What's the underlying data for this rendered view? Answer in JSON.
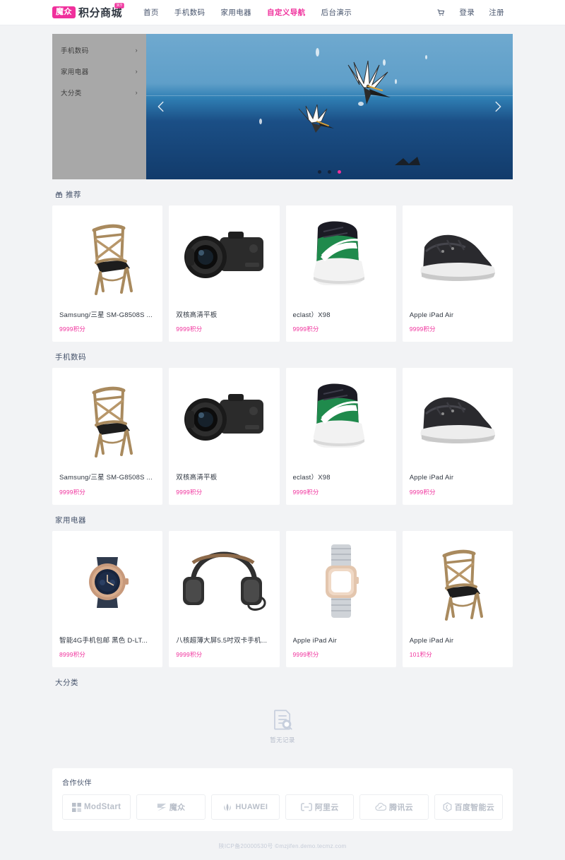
{
  "header": {
    "logo_badge": "魔众",
    "logo_text": "积分商城",
    "logo_sup": "演示",
    "nav": [
      {
        "label": "首页",
        "active": false
      },
      {
        "label": "手机数码",
        "active": false
      },
      {
        "label": "家用电器",
        "active": false
      },
      {
        "label": "自定义导航",
        "active": true
      },
      {
        "label": "后台演示",
        "active": false
      }
    ],
    "cart_icon": "cart-icon",
    "login_label": "登录",
    "register_label": "注册"
  },
  "hero": {
    "side_items": [
      {
        "label": "手机数码",
        "arrow": "›"
      },
      {
        "label": "家用电器",
        "arrow": "›"
      },
      {
        "label": "大分类",
        "arrow": "›"
      }
    ],
    "prev_icon": "chevron-left-icon",
    "next_icon": "chevron-right-icon",
    "dots": [
      {
        "active": false
      },
      {
        "active": false
      },
      {
        "active": true
      }
    ]
  },
  "sections": [
    {
      "title": "推荐",
      "icon": "gift-icon",
      "products": [
        {
          "title": "Samsung/三星 SM-G8508S ...",
          "price": "9999积分",
          "image": "chair"
        },
        {
          "title": "双核高清平板",
          "price": "9999积分",
          "image": "camera"
        },
        {
          "title": "eclast）X98",
          "price": "9999积分",
          "image": "sneaker"
        },
        {
          "title": "Apple iPad Air",
          "price": "9999积分",
          "image": "boot"
        }
      ]
    },
    {
      "title": "手机数码",
      "icon": "",
      "products": [
        {
          "title": "Samsung/三星 SM-G8508S ...",
          "price": "9999积分",
          "image": "chair"
        },
        {
          "title": "双核高清平板",
          "price": "9999积分",
          "image": "camera"
        },
        {
          "title": "eclast）X98",
          "price": "9999积分",
          "image": "sneaker"
        },
        {
          "title": "Apple iPad Air",
          "price": "9999积分",
          "image": "boot"
        }
      ]
    },
    {
      "title": "家用电器",
      "icon": "",
      "products": [
        {
          "title": "智能4G手机包邮 黑色 D-LT...",
          "price": "8999积分",
          "image": "watch"
        },
        {
          "title": "八核超薄大屏5.5吋双卡手机...",
          "price": "9999积分",
          "image": "headphones"
        },
        {
          "title": "Apple iPad Air",
          "price": "9999积分",
          "image": "smartwatch"
        },
        {
          "title": "Apple iPad Air",
          "price": "101积分",
          "image": "chair"
        }
      ]
    }
  ],
  "big_category": {
    "title": "大分类",
    "empty_icon": "empty-records-icon",
    "empty_text": "暂无记录"
  },
  "partners": {
    "title": "合作伙伴",
    "items": [
      {
        "name": "ModStart",
        "icon": "modstart-icon"
      },
      {
        "name": "魔众",
        "icon": "mozhong-icon"
      },
      {
        "name": "HUAWEI",
        "icon": "huawei-icon"
      },
      {
        "name": "阿里云",
        "icon": "aliyun-icon"
      },
      {
        "name": "腾讯云",
        "icon": "tencentcloud-icon"
      },
      {
        "name": "百度智能云",
        "icon": "baiducloud-icon"
      }
    ]
  },
  "footer": {
    "text": "陕ICP备20000530号 ©mzjifen.demo.tecmz.com"
  },
  "colors": {
    "accent": "#f0309c",
    "text": "#46536b",
    "page_bg": "#f2f3f5",
    "card_bg": "#ffffff"
  }
}
